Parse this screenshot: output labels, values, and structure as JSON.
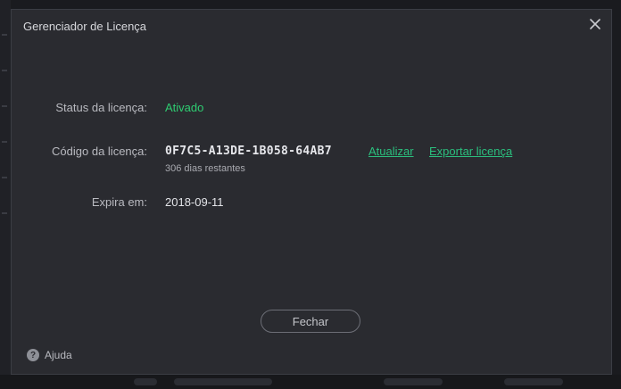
{
  "dialog": {
    "title": "Gerenciador de Licença",
    "close_icon": "close-icon"
  },
  "license": {
    "status_label": "Status da licença:",
    "status_value": "Ativado",
    "code_label": "Código da licença:",
    "code_value": "0F7C5-A13DE-1B058-64AB7",
    "update_link": "Atualizar",
    "export_link": "Exportar licença",
    "days_remaining": "306 dias restantes",
    "expiry_label": "Expira em:",
    "expiry_value": "2018-09-11"
  },
  "actions": {
    "close_label": "Fechar"
  },
  "help": {
    "icon": "help-icon",
    "label": "Ajuda"
  },
  "colors": {
    "accent": "#2ecc71",
    "link": "#2bbf7e",
    "dialog_bg": "#2a2b30"
  }
}
